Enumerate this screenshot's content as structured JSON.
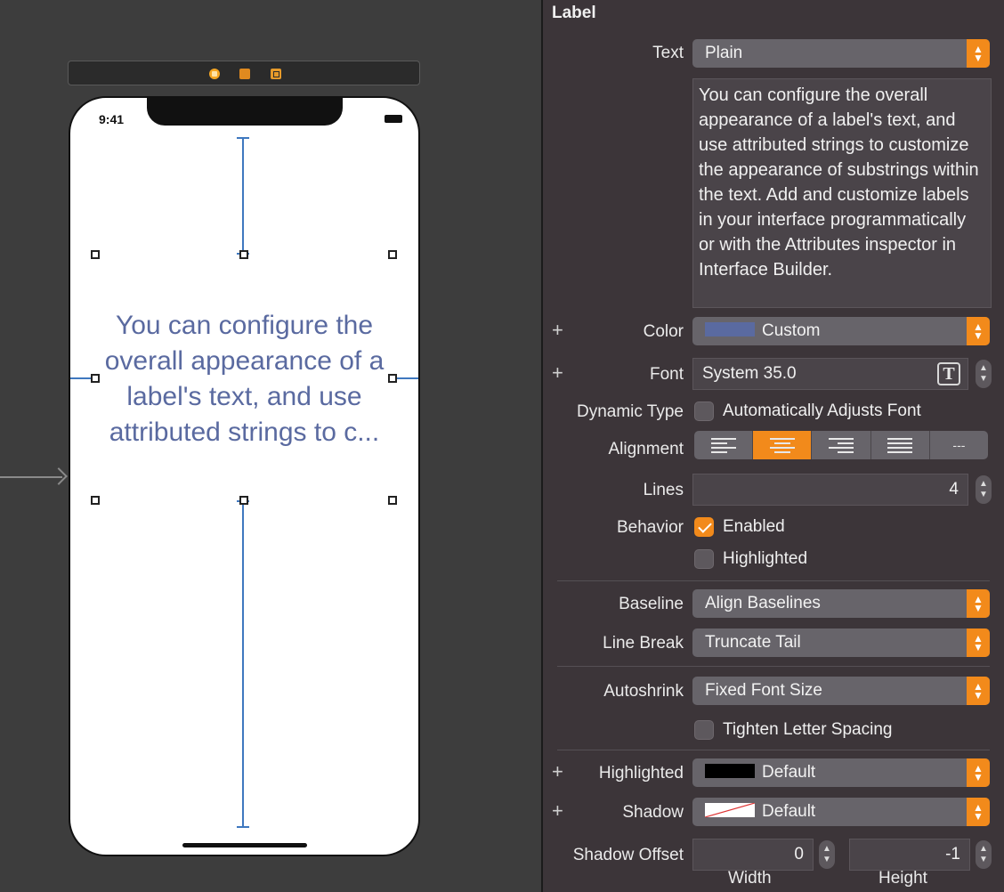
{
  "canvas": {
    "status_time": "9:41",
    "label_text": "You can configure the overall appearance of a label's text, and use attributed strings to c..."
  },
  "inspector": {
    "section_title": "Label",
    "text": {
      "label": "Text",
      "value": "Plain"
    },
    "text_content": "You can configure the overall appearance of a label's text, and use attributed strings to customize the appearance of substrings within the text. Add and customize labels in your interface programmatically or with the Attributes inspector in Interface Builder.",
    "color": {
      "label": "Color",
      "value": "Custom",
      "swatch": "#5a6aa0"
    },
    "font": {
      "label": "Font",
      "value": "System 35.0"
    },
    "dynamic_type": {
      "label": "Dynamic Type",
      "option": "Automatically Adjusts Font",
      "checked": false
    },
    "alignment": {
      "label": "Alignment",
      "options": [
        "left",
        "center",
        "right",
        "justified",
        "natural"
      ],
      "selected": "center",
      "natural_glyph": "---"
    },
    "lines": {
      "label": "Lines",
      "value": "4"
    },
    "behavior": {
      "label": "Behavior",
      "enabled_label": "Enabled",
      "enabled": true,
      "highlighted_label": "Highlighted",
      "highlighted": false
    },
    "baseline": {
      "label": "Baseline",
      "value": "Align Baselines"
    },
    "line_break": {
      "label": "Line Break",
      "value": "Truncate Tail"
    },
    "autoshrink": {
      "label": "Autoshrink",
      "value": "Fixed Font Size"
    },
    "tighten": {
      "label": "Tighten Letter Spacing",
      "checked": false
    },
    "highlighted_color": {
      "label": "Highlighted",
      "value": "Default",
      "swatch": "#000000"
    },
    "shadow": {
      "label": "Shadow",
      "value": "Default",
      "swatch": "#ffffff"
    },
    "shadow_offset": {
      "label": "Shadow Offset",
      "width": "0",
      "height": "-1",
      "width_label": "Width",
      "height_label": "Height"
    }
  },
  "colors": {
    "accent": "#f28a1b",
    "panel_bg": "#3c3539",
    "canvas_bg": "#3d3d3d"
  }
}
